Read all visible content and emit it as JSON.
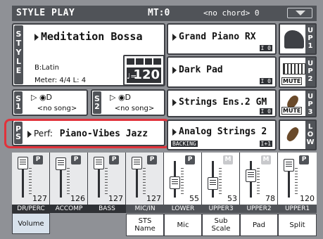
{
  "header": {
    "title": "STYLE PLAY",
    "mt": "MT:0",
    "chord": "<no chord> 0"
  },
  "style": {
    "side": [
      "S",
      "T",
      "Y",
      "L",
      "E"
    ],
    "name": "Meditation Bossa",
    "bank": "B:Latin",
    "meter": "Meter: 4/4  L: 4",
    "tempo": "120",
    "note": "♩="
  },
  "song1": {
    "side": [
      "S",
      "1"
    ],
    "disc": "▷ ◉D",
    "text": "<no song>"
  },
  "song2": {
    "side": [
      "S",
      "2"
    ],
    "disc": "▷ ◉D",
    "text": "<no song>"
  },
  "perf": {
    "side": [
      "P",
      "S"
    ],
    "label": "Perf:",
    "name": "Piano-Vibes Jazz"
  },
  "sounds": [
    {
      "name": "Grand Piano RX",
      "tag": "I 0",
      "side": [
        "U",
        "P",
        "1"
      ],
      "mute": ""
    },
    {
      "name": "Dark Pad",
      "tag": "I 0",
      "side": [
        "U",
        "P",
        "2"
      ],
      "mute": "MUTE"
    },
    {
      "name": "Strings Ens.2 GM",
      "tag": "I 0",
      "side": [
        "U",
        "P",
        "3"
      ],
      "mute": "MUTE"
    },
    {
      "name": "Analog Strings 2",
      "tag": "I+1",
      "sub": "BACKING",
      "side": [
        "L",
        "O",
        "W"
      ],
      "mute": ""
    }
  ],
  "mixer": {
    "channels": [
      {
        "label": "DR/PERC",
        "value": "127",
        "btn": "P"
      },
      {
        "label": "ACCOMP",
        "value": "126",
        "btn": "P"
      },
      {
        "label": "BASS",
        "value": "127",
        "btn": "P"
      },
      {
        "label": "MIC/IN",
        "value": "127",
        "btn": "P"
      },
      {
        "label": "LOWER",
        "value": "55",
        "btn": "P"
      },
      {
        "label": "UPPER3",
        "value": "53",
        "btn": "M"
      },
      {
        "label": "UPPER2",
        "value": "78",
        "btn": "M"
      },
      {
        "label": "UPPER1",
        "value": "120",
        "btn": "P"
      }
    ],
    "tabs": [
      "Volume",
      "STS\nName",
      "Mic",
      "Sub\nScale",
      "Pad",
      "Split"
    ]
  }
}
